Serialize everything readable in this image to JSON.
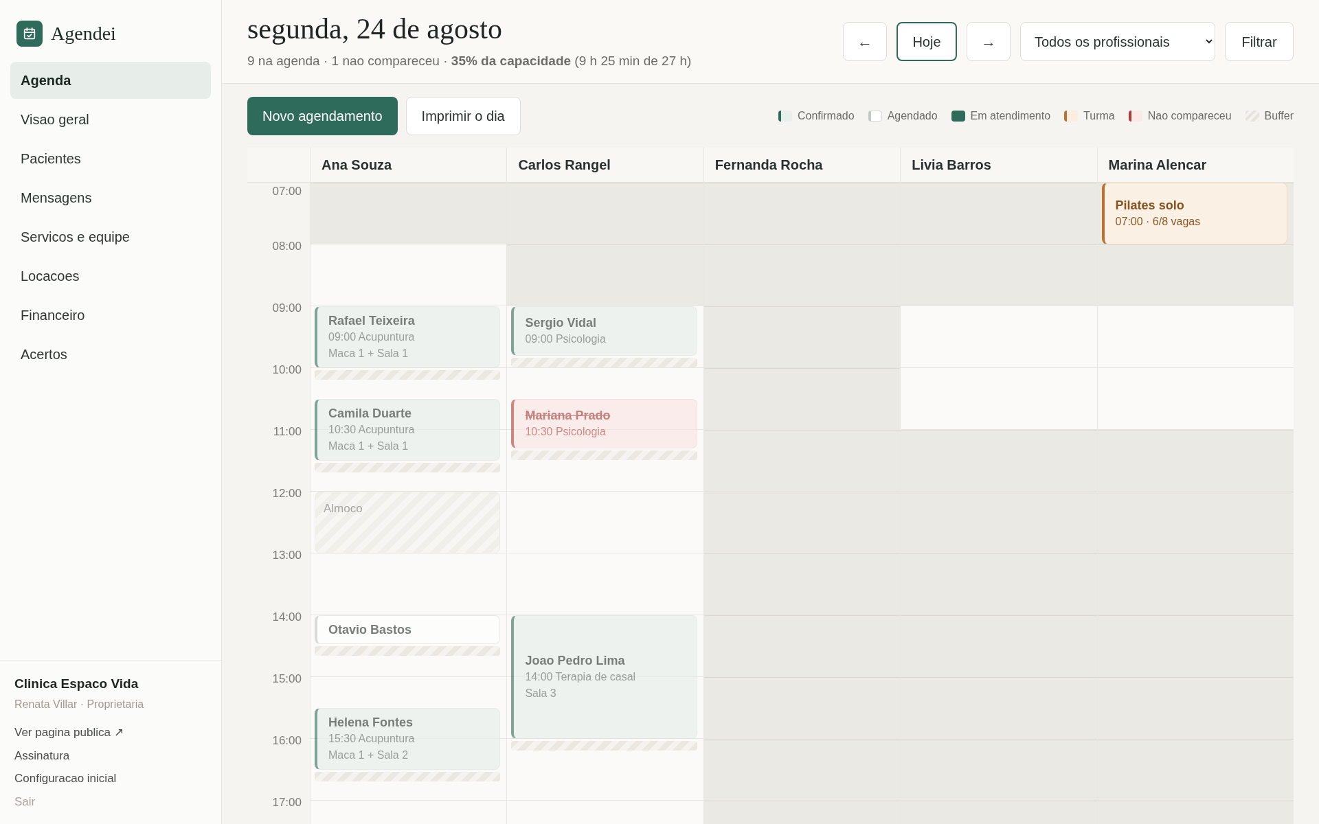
{
  "sidebar": {
    "app_name": "Agendei",
    "nav": [
      {
        "label": "Agenda",
        "selected": true
      },
      {
        "label": "Visao geral",
        "selected": false
      },
      {
        "label": "Pacientes",
        "selected": false
      },
      {
        "label": "Mensagens",
        "selected": false
      },
      {
        "label": "Servicos e equipe",
        "selected": false
      },
      {
        "label": "Locacoes",
        "selected": false
      },
      {
        "label": "Financeiro",
        "selected": false
      },
      {
        "label": "Acertos",
        "selected": false
      }
    ],
    "clinic": "Clinica Espaco Vida",
    "user": "Renata Villar · Proprietaria",
    "links": [
      {
        "label": "Ver pagina publica ↗",
        "kind": "link"
      },
      {
        "label": "Assinatura",
        "kind": "link"
      },
      {
        "label": "Configuracao inicial",
        "kind": "link"
      },
      {
        "label": "Sair",
        "kind": "muted"
      }
    ]
  },
  "header": {
    "title": "segunda, 24 de agosto",
    "summary": "9 na agenda · 1 nao compareceu · **35% da capacidade** (9 h 25 min de 27 h)",
    "prev": "←",
    "today": "Hoje",
    "next": "→",
    "professional_filter": "Todos os profissionais",
    "filter": "Filtrar"
  },
  "toolbar": {
    "new": "Novo agendamento",
    "print": "Imprimir o dia",
    "legend": [
      {
        "label": "Confirmado",
        "kind": "confirmed"
      },
      {
        "label": "Agendado",
        "kind": "scheduled"
      },
      {
        "label": "Em atendimento",
        "kind": "in_progress"
      },
      {
        "label": "Turma",
        "kind": "class"
      },
      {
        "label": "Nao compareceu",
        "kind": "no_show"
      },
      {
        "label": "Buffer",
        "kind": "buffer"
      }
    ]
  },
  "calendar": {
    "hours": [
      "07:00",
      "08:00",
      "09:00",
      "10:00",
      "11:00",
      "12:00",
      "13:00",
      "14:00",
      "15:00",
      "16:00",
      "17:00"
    ],
    "professionals": [
      {
        "name": "Ana Souza",
        "slots": [
          {
            "open": false
          },
          {
            "open": true
          },
          {
            "open": true,
            "events": [
              {
                "kind": "confirmed",
                "long": false,
                "short": false,
                "brief": false,
                "buffer": true,
                "title": "Rafael Teixeira",
                "lines": [
                  "09:00 Acupuntura",
                  "Maca 1 + Sala 1"
                ]
              }
            ]
          },
          {
            "open": true,
            "late_events": [
              {
                "kind": "confirmed",
                "long": false,
                "short": false,
                "brief": false,
                "buffer": true,
                "title": "Camila Duarte",
                "lines": [
                  "10:30 Acupuntura",
                  "Maca 1 + Sala 1"
                ]
              }
            ]
          },
          {
            "open": true
          },
          {
            "open": true,
            "events": [
              {
                "kind": "block",
                "long": false,
                "short": false,
                "brief": false,
                "buffer": false,
                "title": "Almoco"
              }
            ]
          },
          {
            "open": true
          },
          {
            "open": true,
            "events": [
              {
                "kind": "scheduled",
                "long": false,
                "short": false,
                "brief": true,
                "buffer": true,
                "title": "Otavio Bastos"
              }
            ]
          },
          {
            "open": true,
            "late_events": [
              {
                "kind": "confirmed",
                "long": false,
                "short": false,
                "brief": false,
                "buffer": true,
                "title": "Helena Fontes",
                "lines": [
                  "15:30 Acupuntura",
                  "Maca 1 + Sala 2"
                ]
              }
            ]
          },
          {
            "open": true
          },
          {
            "open": true
          }
        ]
      },
      {
        "name": "Carlos Rangel",
        "slots": [
          {
            "open": false
          },
          {
            "open": false
          },
          {
            "open": true,
            "events": [
              {
                "kind": "confirmed",
                "long": false,
                "short": true,
                "brief": false,
                "buffer": true,
                "title": "Sergio Vidal",
                "lines": [
                  "09:00 Psicologia"
                ]
              }
            ]
          },
          {
            "open": true,
            "late_events": [
              {
                "kind": "no_show",
                "long": false,
                "short": true,
                "brief": false,
                "buffer": true,
                "title": "Mariana Prado",
                "lines": [
                  "10:30 Psicologia"
                ]
              }
            ]
          },
          {
            "open": true
          },
          {
            "open": true
          },
          {
            "open": true
          },
          {
            "open": true,
            "events": [
              {
                "kind": "confirmed",
                "long": true,
                "short": false,
                "brief": false,
                "buffer": true,
                "title": "Joao Pedro Lima",
                "lines": [
                  "14:00 Terapia de casal",
                  "Sala 3"
                ]
              }
            ]
          },
          {
            "open": true
          },
          {
            "open": true
          },
          {
            "open": true
          }
        ]
      },
      {
        "name": "Fernanda Rocha",
        "slots": [
          {
            "open": false
          },
          {
            "open": false
          },
          {
            "open": false
          },
          {
            "open": false
          },
          {
            "open": false
          },
          {
            "open": false
          },
          {
            "open": false
          },
          {
            "open": false
          },
          {
            "open": false
          },
          {
            "open": false
          },
          {
            "open": false
          }
        ]
      },
      {
        "name": "Livia Barros",
        "slots": [
          {
            "open": false
          },
          {
            "open": false
          },
          {
            "open": true
          },
          {
            "open": true
          },
          {
            "open": false
          },
          {
            "open": false
          },
          {
            "open": false
          },
          {
            "open": false
          },
          {
            "open": false
          },
          {
            "open": false
          },
          {
            "open": false
          }
        ]
      },
      {
        "name": "Marina Alencar",
        "slots": [
          {
            "open": false,
            "events": [
              {
                "kind": "class",
                "long": false,
                "short": false,
                "brief": false,
                "buffer": false,
                "title": "Pilates solo",
                "lines": [
                  "07:00 · 6/8 vagas"
                ]
              }
            ]
          },
          {
            "open": false
          },
          {
            "open": true
          },
          {
            "open": true
          },
          {
            "open": false
          },
          {
            "open": false
          },
          {
            "open": false
          },
          {
            "open": false
          },
          {
            "open": false
          },
          {
            "open": false
          },
          {
            "open": false
          }
        ]
      }
    ]
  }
}
